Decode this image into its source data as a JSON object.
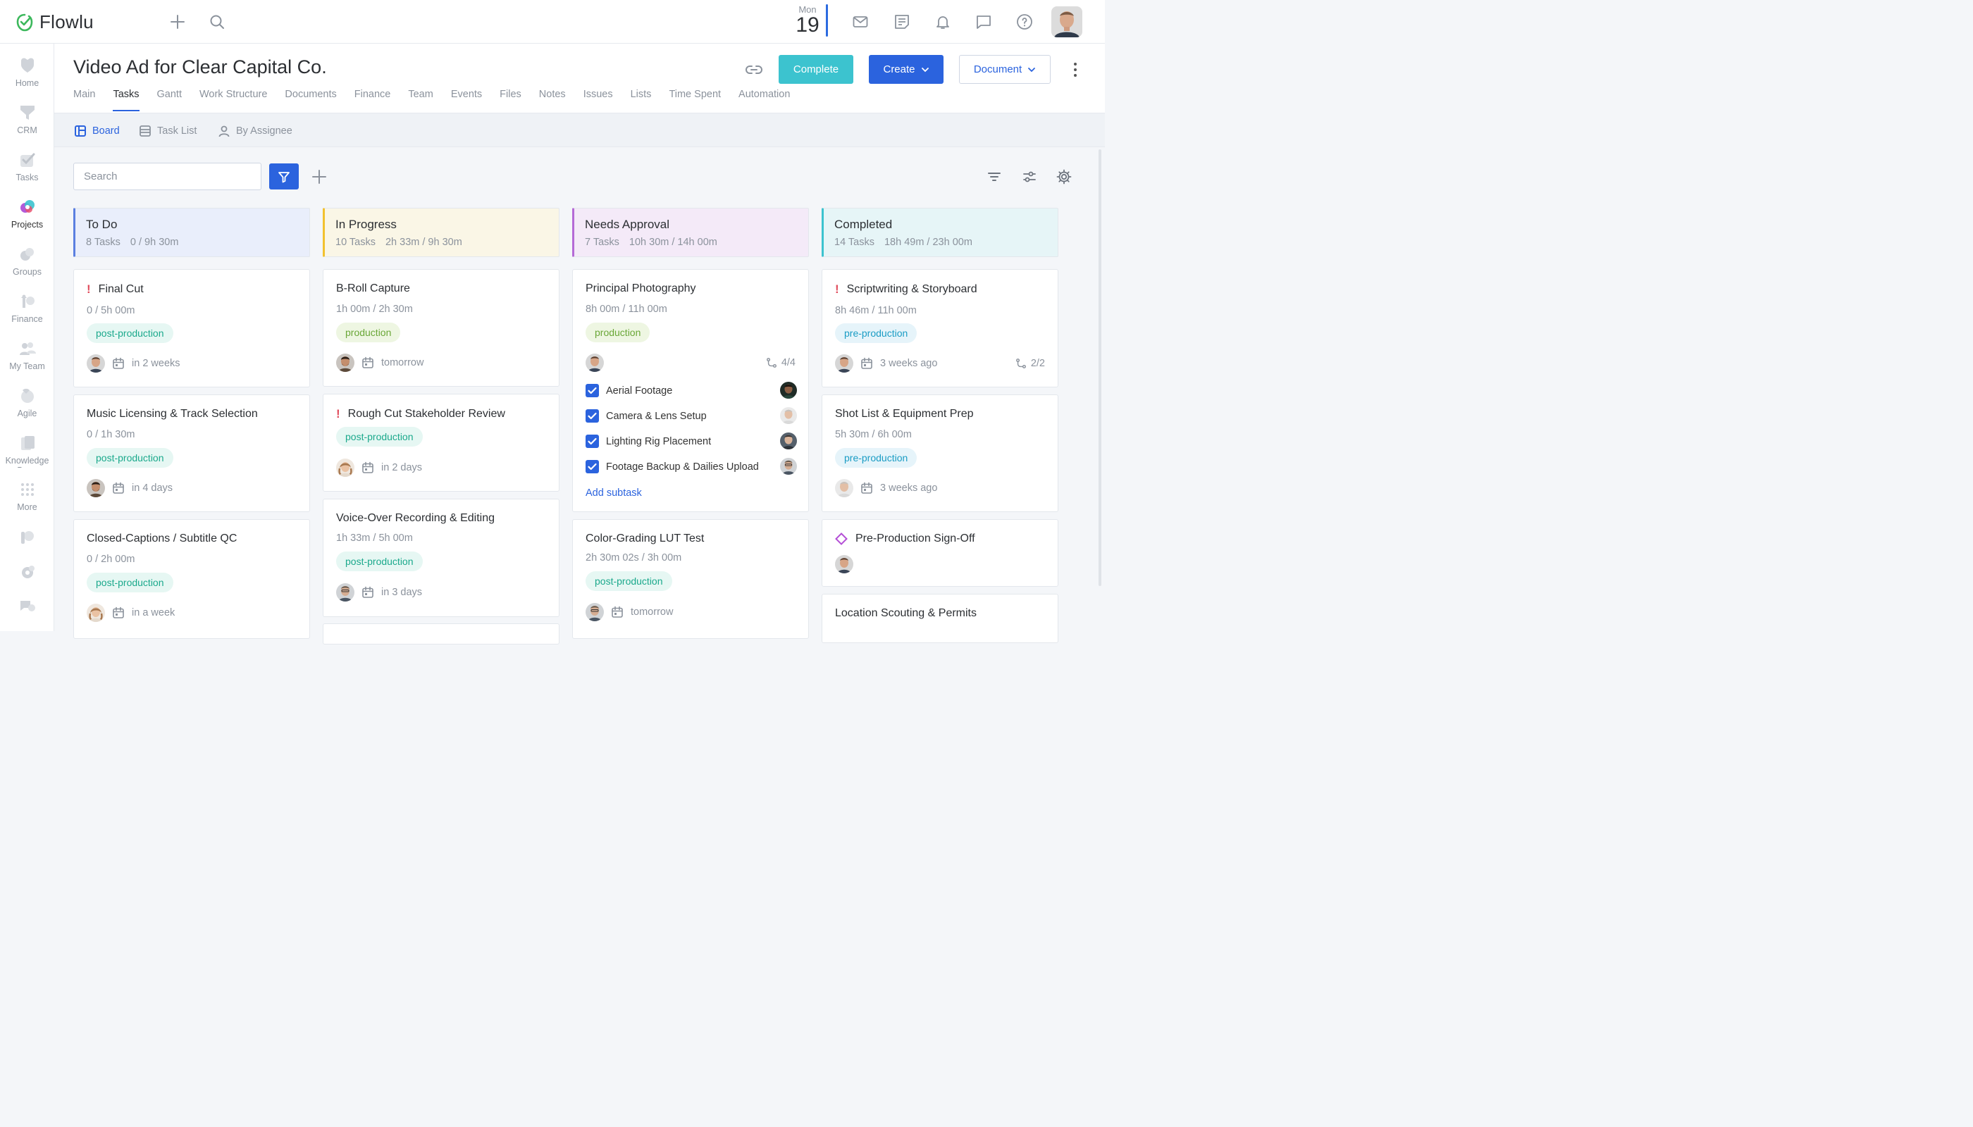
{
  "brand": {
    "name": "Flowlu",
    "accent": "#2b63de",
    "teal": "#3cc3cf",
    "green": "#3cb85c"
  },
  "date": {
    "dow": "Mon",
    "day": "19"
  },
  "topbar_icons": [
    "plus-icon",
    "search-icon",
    "mail-icon",
    "notes-icon",
    "bell-icon",
    "chat-icon",
    "help-icon"
  ],
  "sidebar": {
    "items": [
      {
        "label": "Home"
      },
      {
        "label": "CRM"
      },
      {
        "label": "Tasks"
      },
      {
        "label": "Projects"
      },
      {
        "label": "Groups"
      },
      {
        "label": "Finance"
      },
      {
        "label": "My Team"
      },
      {
        "label": "Agile"
      },
      {
        "label": "Knowledge Base"
      },
      {
        "label": "More"
      }
    ]
  },
  "project": {
    "title": "Video Ad for Clear Capital Co.",
    "buttons": {
      "complete": "Complete",
      "create": "Create",
      "document": "Document"
    },
    "tabs": [
      "Main",
      "Tasks",
      "Gantt",
      "Work Structure",
      "Documents",
      "Finance",
      "Team",
      "Events",
      "Files",
      "Notes",
      "Issues",
      "Lists",
      "Time Spent",
      "Automation"
    ],
    "active_tab": "Tasks"
  },
  "views": {
    "board": "Board",
    "task_list": "Task List",
    "by_assignee": "By Assignee",
    "active": "Board"
  },
  "toolbar": {
    "search_placeholder": "Search"
  },
  "columns": [
    {
      "title": "To Do",
      "count": "8 Tasks",
      "time": "0 / 9h 30m",
      "color": "#5b7fe0",
      "bg": "#e9eefb"
    },
    {
      "title": "In Progress",
      "count": "10 Tasks",
      "time": "2h 33m / 9h 30m",
      "color": "#f2c12e",
      "bg": "#faf6e6"
    },
    {
      "title": "Needs Approval",
      "count": "7 Tasks",
      "time": "10h 30m / 14h 00m",
      "color": "#b56ad6",
      "bg": "#f4eaf8"
    },
    {
      "title": "Completed",
      "count": "14 Tasks",
      "time": "18h 49m / 23h 00m",
      "color": "#3cc3cf",
      "bg": "#e6f5f7"
    }
  ],
  "cards": {
    "todo": [
      {
        "title": "Final Cut",
        "time": "0 / 5h 00m",
        "tag": "post-production",
        "due": "in 2 weeks",
        "urgent": true
      },
      {
        "title": "Music Licensing & Track Selection",
        "time": "0 / 1h 30m",
        "tag": "post-production",
        "due": "in 4 days"
      },
      {
        "title": "Closed-Captions / Subtitle QC",
        "time": "0 / 2h 00m",
        "tag": "post-production",
        "due": "in a week"
      }
    ],
    "progress": [
      {
        "title": "B-Roll Capture",
        "time": "1h 00m / 2h 30m",
        "tag": "production",
        "due": "tomorrow"
      },
      {
        "title": "Rough Cut Stakeholder Review",
        "tag": "post-production",
        "due": "in 2 days",
        "urgent": true
      },
      {
        "title": "Voice-Over Recording & Editing",
        "time": "1h 33m / 5h 00m",
        "tag": "post-production",
        "due": "in 3 days"
      }
    ],
    "approval": [
      {
        "title": "Principal Photography",
        "time": "8h 00m / 11h 00m",
        "tag": "production",
        "subcount": "4/4",
        "subtasks": [
          "Aerial Footage",
          "Camera & Lens Setup",
          "Lighting Rig Placement",
          "Footage Backup & Dailies Upload"
        ],
        "add_subtask": "Add subtask"
      },
      {
        "title": "Color-Grading LUT Test",
        "time": "2h 30m 02s / 3h 00m",
        "tag": "post-production",
        "due": "tomorrow"
      }
    ],
    "completed": [
      {
        "title": "Scriptwriting & Storyboard",
        "time": "8h 46m / 11h 00m",
        "tag": "pre-production",
        "due": "3 weeks ago",
        "subcount": "2/2",
        "urgent": true
      },
      {
        "title": "Shot List & Equipment Prep",
        "time": "5h 30m / 6h 00m",
        "tag": "pre-production",
        "due": "3 weeks ago"
      },
      {
        "title": "Pre-Production Sign-Off"
      },
      {
        "title": "Location Scouting & Permits"
      }
    ]
  }
}
